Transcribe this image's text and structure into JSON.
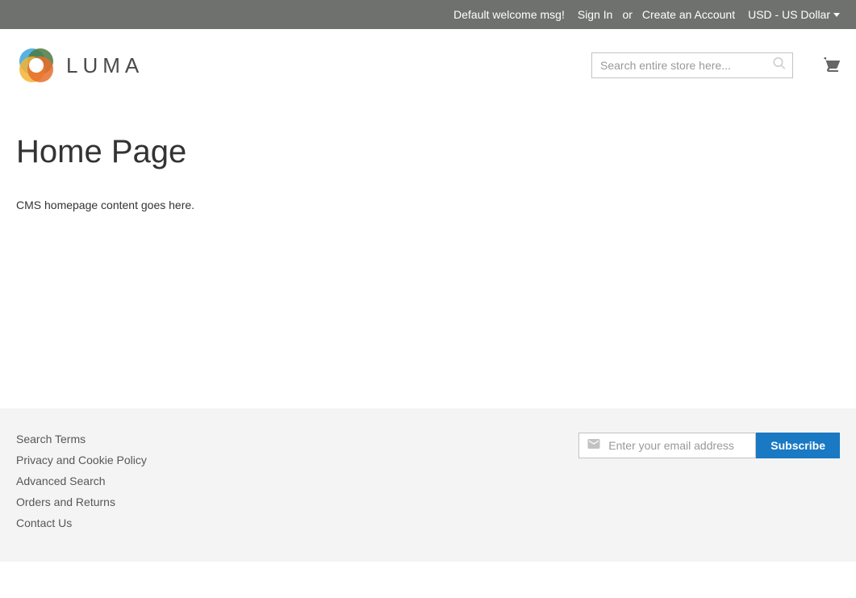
{
  "topbar": {
    "welcome": "Default welcome msg!",
    "sign_in": "Sign In",
    "or": "or",
    "create_account": "Create an Account",
    "currency": "USD - US Dollar"
  },
  "header": {
    "logo_text": "LUMA",
    "search_placeholder": "Search entire store here..."
  },
  "main": {
    "title": "Home Page",
    "content": "CMS homepage content goes here."
  },
  "footer": {
    "links": {
      "search_terms": "Search Terms",
      "privacy": "Privacy and Cookie Policy",
      "advanced_search": "Advanced Search",
      "orders_returns": "Orders and Returns",
      "contact": "Contact Us"
    },
    "newsletter_placeholder": "Enter your email address",
    "subscribe": "Subscribe"
  }
}
